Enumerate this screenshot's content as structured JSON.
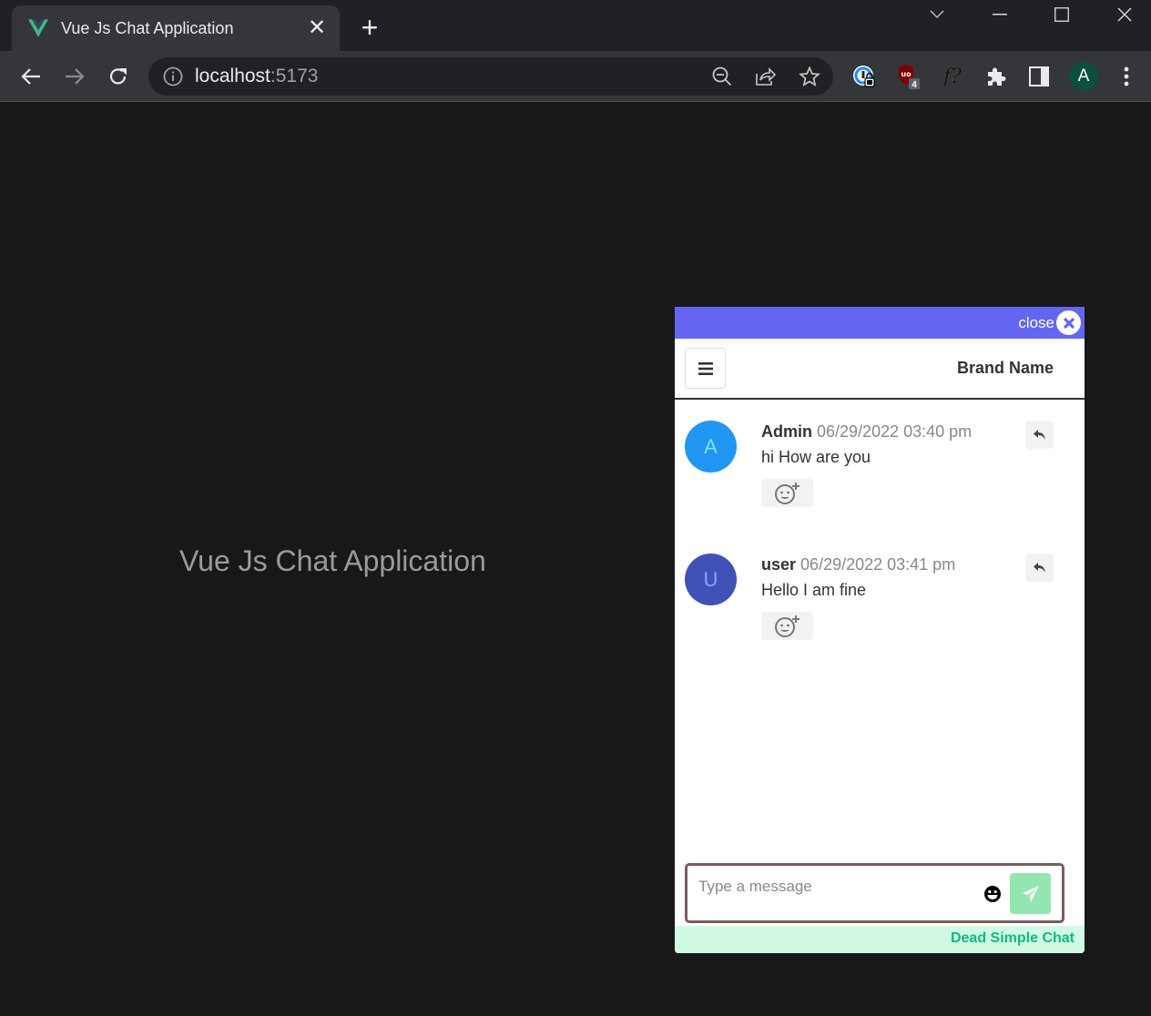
{
  "browser": {
    "tab": {
      "title": "Vue Js Chat Application",
      "favicon": "vue-logo-icon"
    },
    "new_tab_label": "+",
    "address": {
      "host": "localhost",
      "port": ":5173"
    },
    "extensions": [
      {
        "name": "1password-icon"
      },
      {
        "name": "ublock-origin-icon",
        "badge": "4"
      },
      {
        "name": "font-finder-icon",
        "label": "f?"
      },
      {
        "name": "extensions-puzzle-icon"
      },
      {
        "name": "side-panel-icon"
      },
      {
        "name": "profile-avatar",
        "label": "A"
      }
    ],
    "colors": {
      "titlebar": "#202124",
      "toolbar": "#35363a",
      "profile": "#0b4f3f"
    }
  },
  "page": {
    "heading": "Vue Js Chat Application"
  },
  "chat": {
    "close_label": "close",
    "brand_name": "Brand Name",
    "accent_color": "#6366f1",
    "messages": [
      {
        "avatar_letter": "A",
        "avatar_color": "#2196f3",
        "avatar_text_color": "#7fe3ff",
        "sender": "Admin",
        "timestamp": "06/29/2022 03:40 pm",
        "text": "hi How are you"
      },
      {
        "avatar_letter": "U",
        "avatar_color": "#3f51b5",
        "avatar_text_color": "#8fa0ff",
        "sender": "user",
        "timestamp": "06/29/2022 03:41 pm",
        "text": "Hello I am fine"
      }
    ],
    "input": {
      "placeholder": "Type a message",
      "value": ""
    },
    "footer_label": "Dead Simple Chat"
  }
}
